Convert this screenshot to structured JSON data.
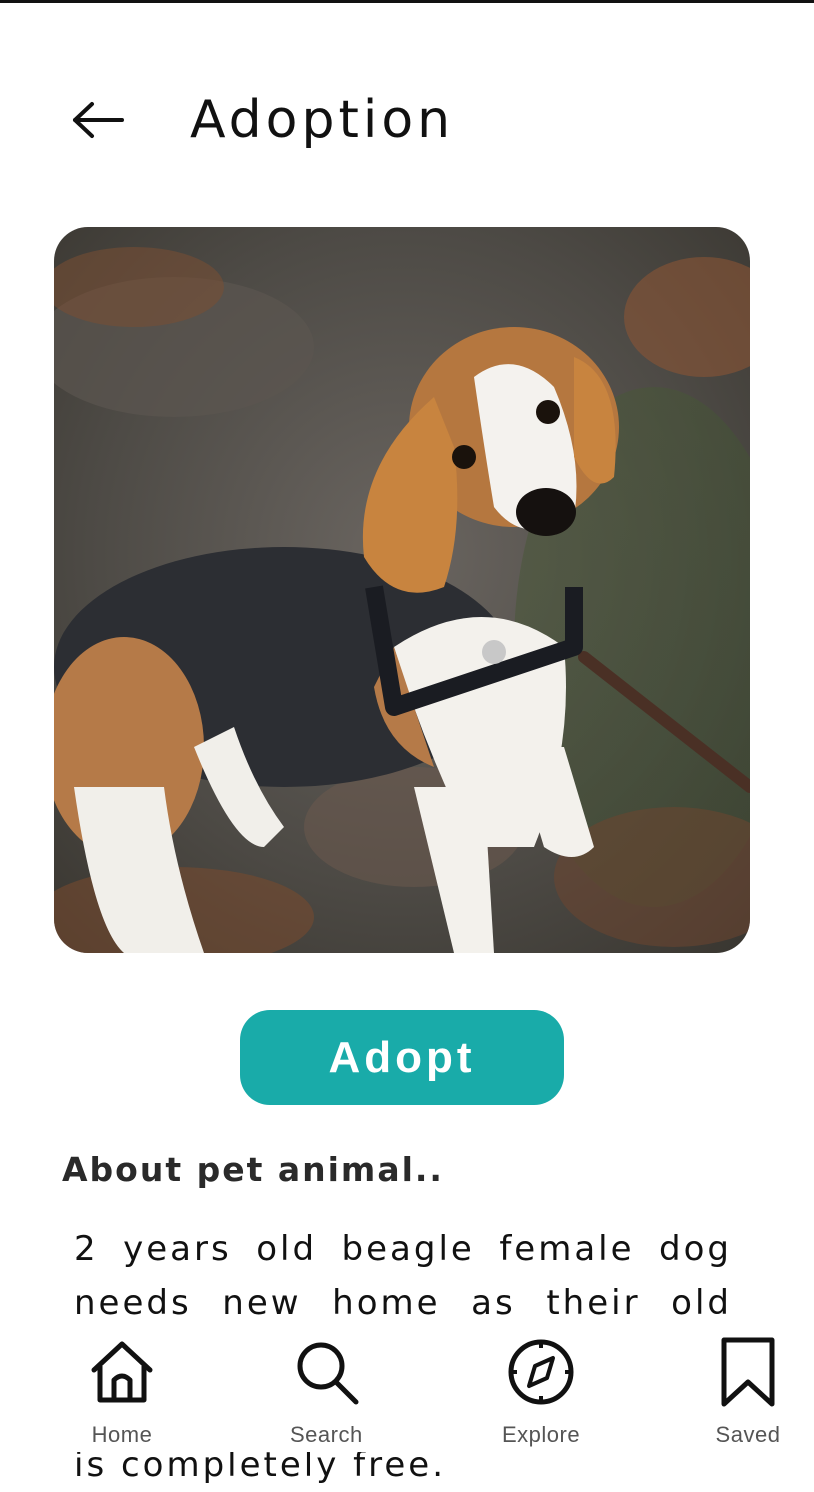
{
  "header": {
    "title": "Adoption",
    "back_icon": "arrow-left-icon"
  },
  "pet": {
    "photo": "beagle-dog-photo",
    "adopt_label": "Adopt",
    "about_heading": "About pet animal..",
    "about_text": "2 years old beagle female dog needs new home as their old owner can not take care of her anymore. The adoption process is completely free."
  },
  "nav": {
    "items": [
      {
        "label": "Home",
        "icon": "home-icon"
      },
      {
        "label": "Search",
        "icon": "search-icon"
      },
      {
        "label": "Explore",
        "icon": "compass-icon"
      },
      {
        "label": "Saved",
        "icon": "bookmark-icon"
      }
    ]
  },
  "colors": {
    "accent": "#19aba9",
    "text": "#111111",
    "nav_label": "#555555"
  }
}
